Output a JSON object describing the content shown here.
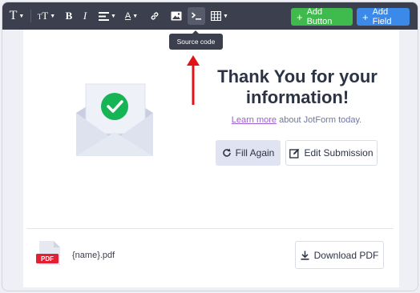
{
  "toolbar": {
    "text_style_glyph": "T",
    "text_size_glyph": "TT",
    "bold_glyph": "B",
    "italic_glyph": "I",
    "font_color_glyph": "A",
    "add_button_label": "Add Button",
    "add_field_label": "Add Field",
    "add_glyph": "+",
    "icons": [
      "text-style-icon",
      "text-size-icon",
      "bold-icon",
      "italic-icon",
      "align-icon",
      "font-color-icon",
      "link-icon",
      "image-icon",
      "source-code-icon",
      "table-icon"
    ]
  },
  "tooltip": {
    "text": "Source code"
  },
  "thankyou": {
    "heading_line1": "Thank You for your",
    "heading_line2": "information!",
    "learn_more": "Learn more",
    "sub_rest": " about JotForm today.",
    "fill_again": "Fill Again",
    "edit_submission": "Edit Submission"
  },
  "pdf": {
    "badge": "PDF",
    "filename": "{name}.pdf",
    "download": "Download PDF"
  },
  "colors": {
    "toolbar_bg": "#3c3f4d",
    "add_button": "#3fba4c",
    "add_field": "#3b89e8",
    "check_green": "#16b455",
    "arrow_red": "#e0131a",
    "pdf_red": "#e21f33",
    "link_purple": "#9b5fd1"
  }
}
